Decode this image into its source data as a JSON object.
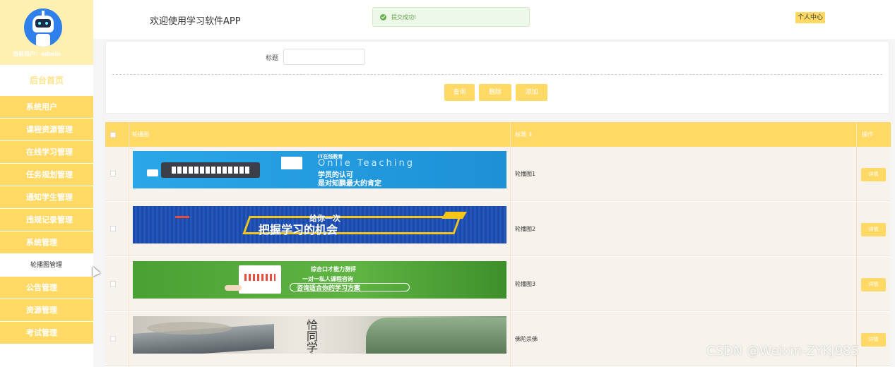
{
  "sidebar": {
    "current_user": "当前用户：admin",
    "home": "后台首页",
    "items": [
      {
        "label": "系统用户"
      },
      {
        "label": "课程资源管理"
      },
      {
        "label": "在线学习管理"
      },
      {
        "label": "任务规划管理"
      },
      {
        "label": "通知学生管理"
      },
      {
        "label": "违规记录管理"
      },
      {
        "label": "系统管理"
      }
    ],
    "sub_item": "轮播图管理",
    "items_after": [
      {
        "label": "公告管理"
      },
      {
        "label": "资源管理"
      },
      {
        "label": "考试管理"
      }
    ]
  },
  "header": {
    "welcome": "欢迎使用学习软件APP",
    "toast": "提交成功!",
    "profile": "个人中心"
  },
  "search": {
    "label": "标题",
    "value": "",
    "query": "查询",
    "delete": "删除",
    "add": "添加"
  },
  "table": {
    "columns": {
      "image": "轮播图",
      "title": "标题 ⇕",
      "operation": "操作"
    },
    "rows": [
      {
        "title": "轮播图1",
        "detail": "详情",
        "banner_lines": [
          "IT在线教育",
          "Onlie Teaching",
          "学员的认可",
          "是对知鹏最大的肯定"
        ]
      },
      {
        "title": "轮播图2",
        "detail": "详情",
        "banner_lines": [
          "给你一次",
          "把握学习的机会"
        ]
      },
      {
        "title": "轮播图3",
        "detail": "详情",
        "banner_lines": [
          "综合口才能力测评",
          "一对一私人课程咨询",
          "咨询适合你的学习方案"
        ]
      },
      {
        "title": "佛陀杀佛",
        "detail": "详情",
        "banner_lines": [
          "恰同学少年"
        ]
      }
    ]
  },
  "watermark": "CSDN @Weixin-ZYKJ985",
  "colors": {
    "accent": "#fed966",
    "sidebar_head": "#fdf0b0",
    "success": "#67a04b"
  }
}
